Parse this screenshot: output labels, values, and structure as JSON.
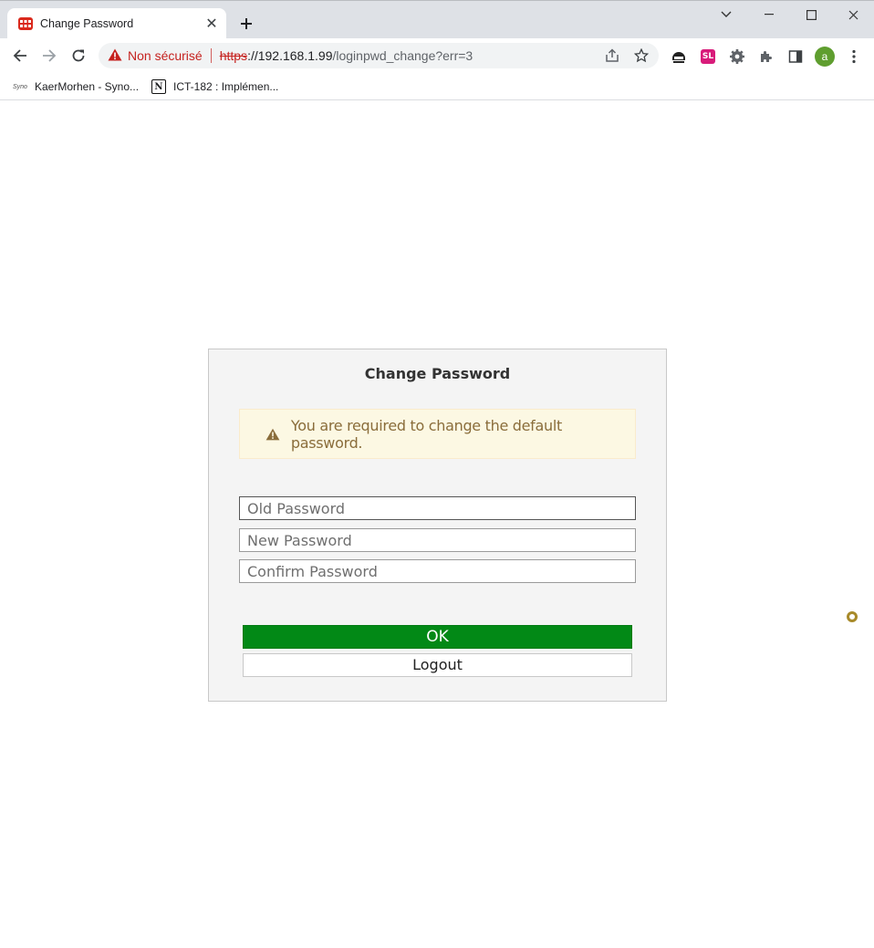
{
  "browser": {
    "tab_title": "Change Password",
    "security_label": "Non sécurisé",
    "url_scheme": "https",
    "url_host": "://192.168.1.99",
    "url_path": "/loginpwd_change?err=3",
    "profile_initial": "a",
    "extension_badge": "SL",
    "bookmarks": [
      {
        "icon_text": "Syno",
        "label": "KaerMorhen - Syno..."
      },
      {
        "icon_text": "N",
        "label": "ICT-182 : Implémen..."
      }
    ]
  },
  "page": {
    "title": "Change Password",
    "alert_text": "You are required to change the default password.",
    "fields": {
      "old_placeholder": "Old Password",
      "new_placeholder": "New Password",
      "confirm_placeholder": "Confirm Password"
    },
    "ok_label": "OK",
    "logout_label": "Logout"
  },
  "colors": {
    "ok_button": "#028916",
    "alert_bg": "#fcf8e3",
    "alert_text": "#8a6d3b",
    "insecure": "#c5221f"
  }
}
